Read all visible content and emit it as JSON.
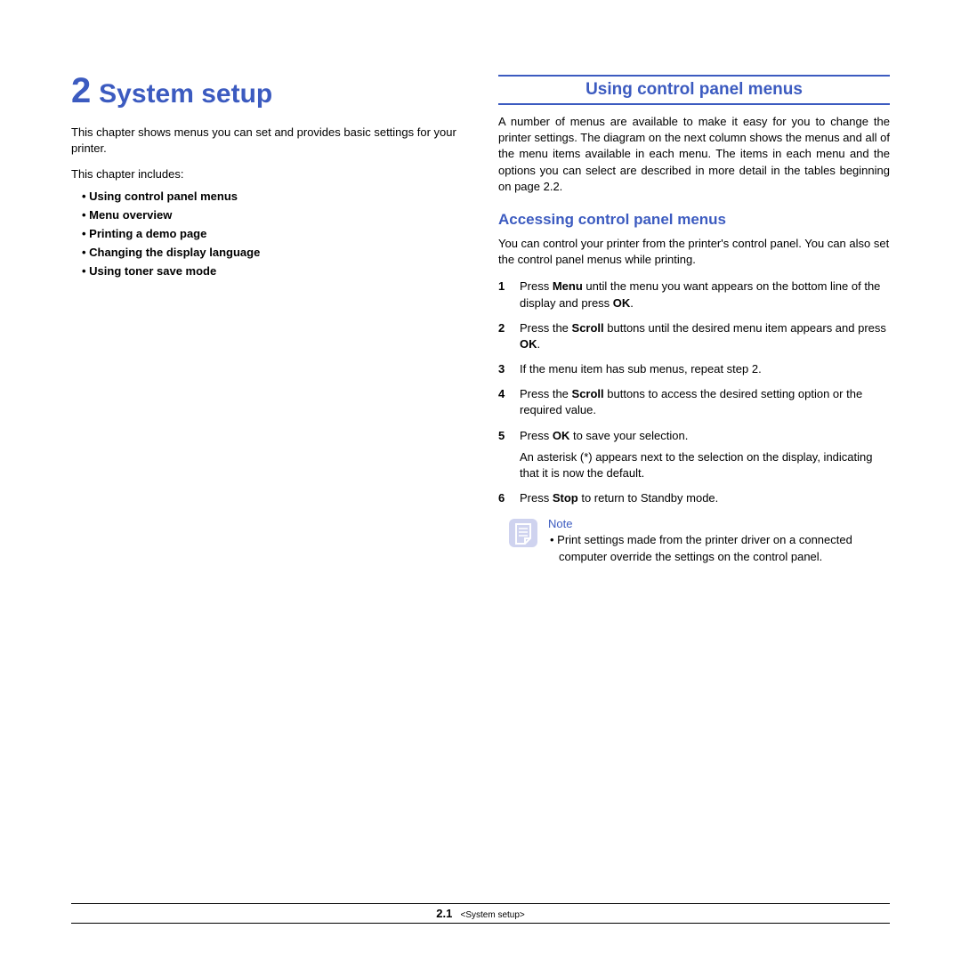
{
  "left": {
    "chapter_number": "2",
    "chapter_title": "System setup",
    "intro": "This chapter shows menus you can set and provides basic settings for your printer.",
    "includes_label": "This chapter includes:",
    "toc": [
      "Using control panel menus",
      "Menu overview",
      "Printing a demo page",
      "Changing the display language",
      "Using toner save mode"
    ]
  },
  "right": {
    "section_heading": "Using control panel menus",
    "intro": "A number of menus are available to make it easy for you to change the printer settings. The diagram on the next column shows the menus and all of the menu items available in each menu. The items in each menu and the options you can select are described in more detail in the tables beginning on page 2.2.",
    "subheading": "Accessing control panel menus",
    "sub_intro": "You can control your printer from the printer's control panel. You can also set the control panel menus while printing.",
    "steps": [
      {
        "n": "1",
        "html": "Press <b>Menu</b> until the menu you want appears on the bottom line of the display and press <b>OK</b>."
      },
      {
        "n": "2",
        "html": "Press the <b>Scroll</b> buttons until the desired menu item appears and press <b>OK</b>."
      },
      {
        "n": "3",
        "html": "If the menu item has sub menus, repeat step 2."
      },
      {
        "n": "4",
        "html": "Press the <b>Scroll</b> buttons to access the desired setting option or the required value."
      },
      {
        "n": "5",
        "html": "Press <b>OK</b> to save your selection.",
        "extra": "An asterisk (*) appears next to the selection on the display, indicating that it is now the default."
      },
      {
        "n": "6",
        "html": "Press <b>Stop</b> to return to Standby mode."
      }
    ],
    "note_label": "Note",
    "note_text": "Print settings made from the printer driver on a connected computer override the settings on the control panel."
  },
  "footer": {
    "page_number": "2.1",
    "chapter_tag": "<System setup>"
  }
}
